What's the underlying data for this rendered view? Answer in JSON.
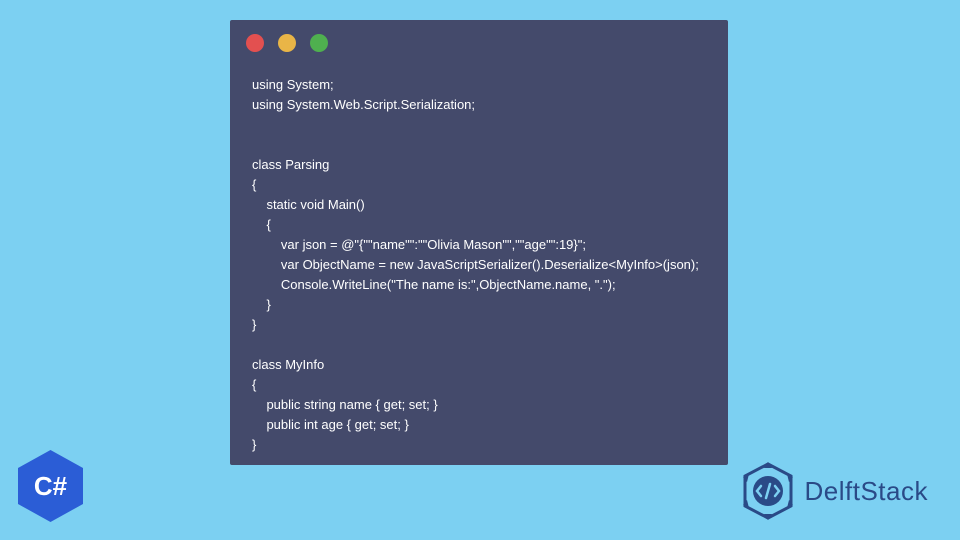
{
  "code": {
    "line1": "using System;",
    "line2": "using System.Web.Script.Serialization;",
    "line3": "",
    "line4": "",
    "line5": "class Parsing",
    "line6": "{",
    "line7": "    static void Main()",
    "line8": "    {",
    "line9": "        var json = @\"{\"\"name\"\":\"\"Olivia Mason\"\",\"\"age\"\":19}\";",
    "line10": "        var ObjectName = new JavaScriptSerializer().Deserialize<MyInfo>(json);",
    "line11": "        Console.WriteLine(\"The name is:\",ObjectName.name, \".\");",
    "line12": "    }",
    "line13": "}",
    "line14": "",
    "line15": "class MyInfo",
    "line16": "{",
    "line17": "    public string name { get; set; }",
    "line18": "    public int age { get; set; }",
    "line19": "}"
  },
  "badges": {
    "csharp": "C#",
    "brand": "DelftStack"
  }
}
